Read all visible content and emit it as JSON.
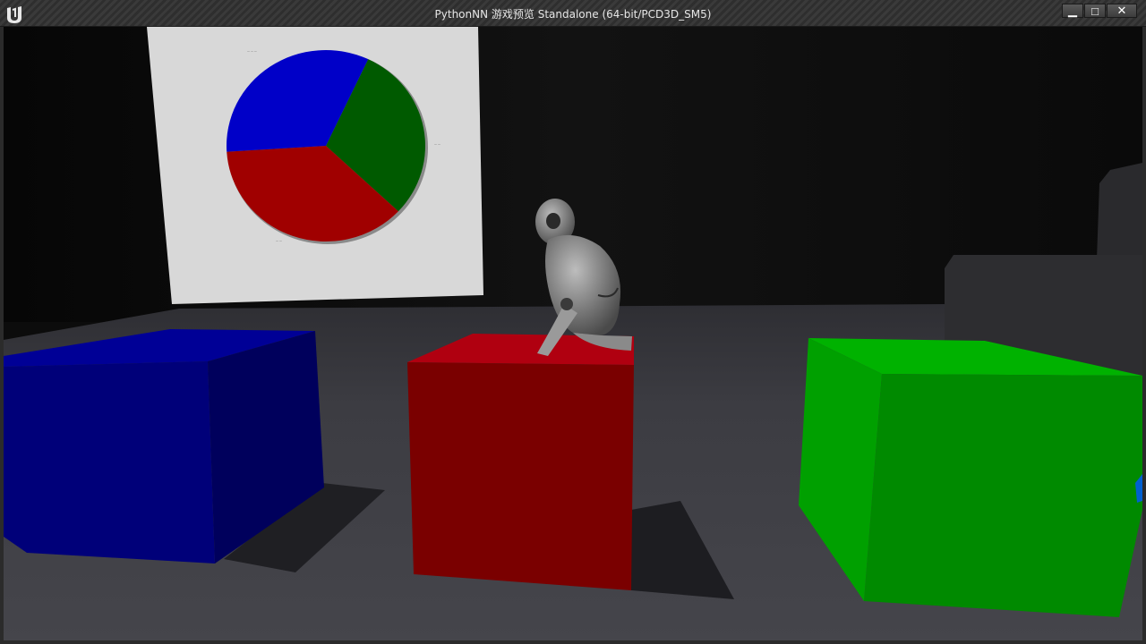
{
  "window": {
    "title": "PythonNN 游戏预览 Standalone (64-bit/PCD3D_SM5)",
    "minimize_glyph": "▁",
    "maximize_glyph": "□",
    "close_glyph": "✕",
    "logo_icon": "unreal-logo-icon"
  },
  "scene": {
    "objects": [
      "pie-chart-board",
      "blue-cube",
      "red-cube",
      "green-cube",
      "robot-mannequin"
    ],
    "colors": {
      "blue_cube": "#00007a",
      "red_cube": "#8a0000",
      "green_cube": "#00a400",
      "floor": "#3b3b40",
      "wall": "#0e0e0e"
    }
  },
  "chart_data": {
    "type": "pie",
    "slices": [
      {
        "color": "#0000c8",
        "value": 33
      },
      {
        "color": "#005a00",
        "value": 30
      },
      {
        "color": "#a00000",
        "value": 37
      }
    ]
  }
}
